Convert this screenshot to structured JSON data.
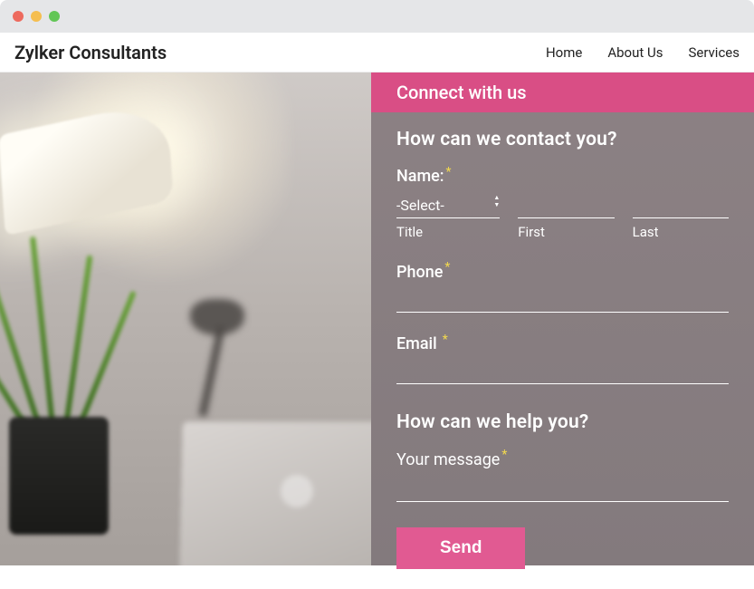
{
  "brand": "Zylker Consultants",
  "nav": {
    "home": "Home",
    "about": "About Us",
    "services": "Services"
  },
  "form": {
    "header": "Connect with us",
    "contact_title": "How can we contact you?",
    "name_label": "Name:",
    "title_select": "-Select-",
    "title_sublabel": "Title",
    "first_sublabel": "First",
    "last_sublabel": "Last",
    "phone_label": "Phone",
    "email_label": "Email",
    "help_title": "How can we help you?",
    "message_label": "Your message",
    "send_label": "Send",
    "required_mark": "*"
  },
  "colors": {
    "accent": "#d94e85",
    "required": "#f2d94e"
  }
}
